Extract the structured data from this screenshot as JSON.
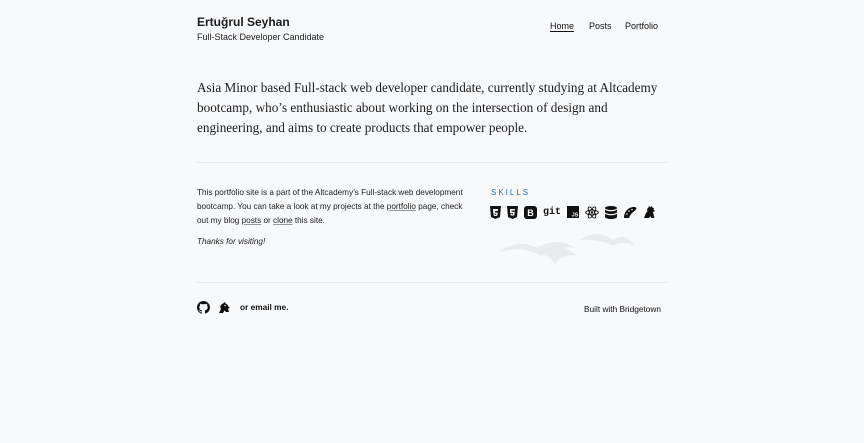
{
  "header": {
    "name": "Ertuğrul Seyhan",
    "role": "Full-Stack Developer Candidate",
    "nav": [
      {
        "label": "Home"
      },
      {
        "label": "Posts"
      },
      {
        "label": "Portfolio"
      }
    ]
  },
  "intro": {
    "part1": "Asia Minor based Full-stack web developer candidate, currently studying at ",
    "link": "Altcademy",
    "part2": " bootcamp, who’s enthusiastic about working on the intersection of design and engineering, and aims to create products that empower people."
  },
  "about": {
    "text1": "This portfolio site is a part of the Altcademy’s Full-stack web development bootcamp. You can take a look at my projects at the ",
    "portfolio_link": "portfolio",
    "text2": " page, check out my blog ",
    "posts_link": "posts",
    "text3": " or ",
    "clone_link": "clone",
    "text4": " this site.",
    "thanks": "Thanks for visiting!"
  },
  "skills": {
    "heading": "SKILLS",
    "icons": [
      "html5-icon",
      "css3-icon",
      "bootstrap-icon",
      "git-icon",
      "javascript-icon",
      "react-icon",
      "database-icon",
      "ruby-on-rails-icon",
      "godzilla-icon"
    ],
    "git_label": "git",
    "js_label": "JS",
    "b_label": "B"
  },
  "footer": {
    "email_text": "or email me.",
    "built_with": "Built with Bridgetown"
  },
  "colors": {
    "background": "#f8f9fb",
    "text": "#1c1c1c",
    "skills_heading": "#2f6fb3",
    "rule": "#e6e8ec"
  }
}
